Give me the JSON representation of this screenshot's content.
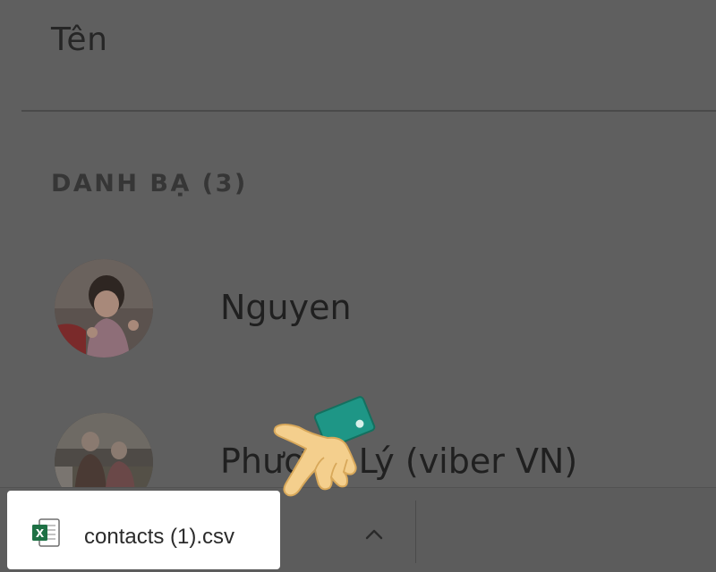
{
  "contacts_list": {
    "column_header": "Tên",
    "section_title": "DANH BẠ (3)",
    "items": [
      {
        "name": "Nguyen"
      },
      {
        "name": "Phương Lý (viber VN)"
      }
    ]
  },
  "download_bar": {
    "file_name": "contacts (1).csv",
    "file_icon": "excel-csv-icon",
    "expand_icon": "chevron-up-icon"
  },
  "overlay": {
    "pointer_icon": "hand-pointer-icon"
  }
}
